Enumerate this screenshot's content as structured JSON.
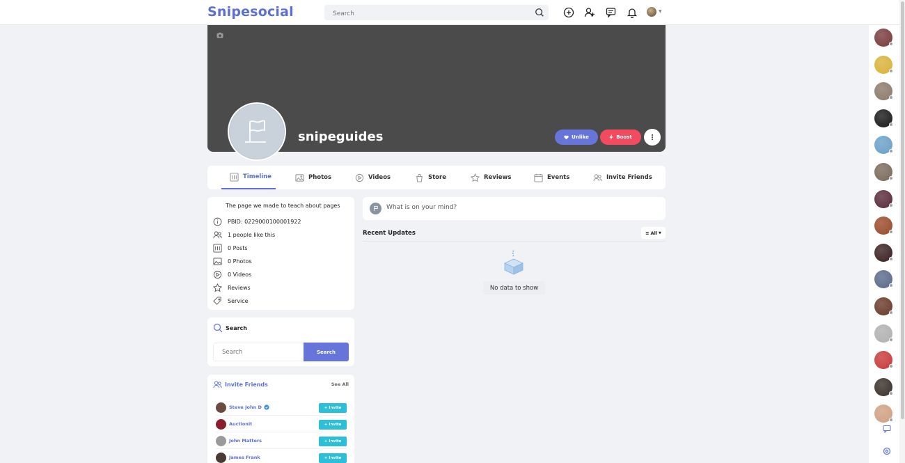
{
  "header": {
    "logo": "Snipesocial",
    "search_placeholder": "Search",
    "icons": [
      "plus-circle-icon",
      "add-user-icon",
      "messages-icon",
      "bell-icon",
      "avatar"
    ]
  },
  "page": {
    "name": "snipeguides",
    "unlike_label": "Unlike",
    "boost_label": "Boost"
  },
  "tabs": [
    {
      "label": "Timeline",
      "icon": "timeline-icon",
      "active": true
    },
    {
      "label": "Photos",
      "icon": "photo-icon"
    },
    {
      "label": "Videos",
      "icon": "video-icon"
    },
    {
      "label": "Store",
      "icon": "store-icon"
    },
    {
      "label": "Reviews",
      "icon": "star-icon"
    },
    {
      "label": "Events",
      "icon": "calendar-icon"
    },
    {
      "label": "Invite Friends",
      "icon": "users-icon"
    }
  ],
  "about": {
    "description": "The page we made to teach about pages",
    "rows": [
      {
        "icon": "info-icon",
        "text": "PBID: 0229000100001922"
      },
      {
        "icon": "users-icon",
        "text": "1 people like this"
      },
      {
        "icon": "posts-icon",
        "text": "0 Posts"
      },
      {
        "icon": "photo-icon",
        "text": "0 Photos"
      },
      {
        "icon": "video-icon",
        "text": "0 Videos"
      },
      {
        "icon": "star-icon",
        "text": "Reviews"
      },
      {
        "icon": "tag-icon",
        "text": "Service"
      }
    ]
  },
  "search_card": {
    "title": "Search",
    "placeholder": "Search",
    "button": "Search"
  },
  "invite_card": {
    "title": "Invite Friends",
    "see_all": "See All",
    "invite_label": "Invite",
    "friends": [
      {
        "name": "Steve John D",
        "verified": true,
        "color": "#6b4a3f"
      },
      {
        "name": "Auctionit",
        "verified": false,
        "color": "#8b1e2b"
      },
      {
        "name": "John Matters",
        "verified": false,
        "color": "#9a9a9a"
      },
      {
        "name": "James Frank",
        "verified": false,
        "color": "#4a3a34"
      }
    ]
  },
  "feed": {
    "composer_placeholder": "What is on your mind?",
    "recent_title": "Recent Updates",
    "filter_label": "All",
    "empty_text": "No data to show"
  },
  "colors": {
    "brand": "#5b6fd6",
    "unlike": "#6774d9",
    "boost": "#f24a5e",
    "invite": "#2cc0d8",
    "cover": "#4b4b4b"
  },
  "online_users": [
    "#7a3b3b",
    "#d9b23a",
    "#8c7a6a",
    "#1a1a1a",
    "#6aa0c8",
    "#7a6a5a",
    "#5a2a3a",
    "#9a4a2a",
    "#3a2020",
    "#5a6a8a",
    "#6a3a2a",
    "#b0b0b0",
    "#c83a3a",
    "#3a3028",
    "#d0a080"
  ]
}
